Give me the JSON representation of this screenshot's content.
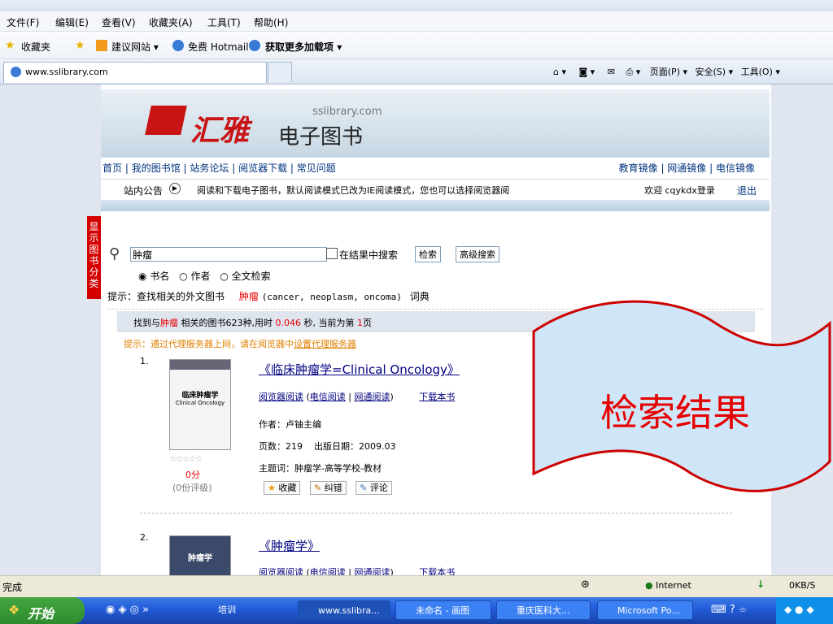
{
  "menu": [
    "文件(F)",
    "编辑(E)",
    "查看(V)",
    "收藏夹(A)",
    "工具(T)",
    "帮助(H)"
  ],
  "favbar": {
    "favorites": "收藏夹",
    "suggested": "建议网站",
    "hotmail": "免费 Hotmail",
    "addons": "获取更多加载项"
  },
  "tab": {
    "title": "www.sslibrary.com"
  },
  "commandbar": {
    "page": "页面(P)",
    "safety": "安全(S)",
    "tools": "工具(O)"
  },
  "banner": {
    "logo": "汇雅",
    "subtitle": "电子图书",
    "domain": "sslibrary.com"
  },
  "nav": [
    "首页",
    "我的图书馆",
    "站务论坛",
    "阅览器下载",
    "常见问题"
  ],
  "mirrors": [
    "教育镜像",
    "网通镜像",
    "电信镜像"
  ],
  "notice": {
    "label": "站内公告",
    "text": "阅读和下载电子图书，默认阅读模式已改为IE阅读模式，您也可以选择阅览器阅",
    "welcome": "欢迎 cqykdx登录",
    "logout": "退出"
  },
  "sidetab": "显示图书分类",
  "search": {
    "value": "肿瘤",
    "in_results": "在结果中搜索",
    "search_btn": "检索",
    "advanced_btn": "高级搜索",
    "options": [
      "书名",
      "作者",
      "全文检索"
    ],
    "hint_prefix": "提示：查找相关的外文图书",
    "hint_term": "肿瘤",
    "hint_terms": "(cancer, neoplasm, oncoma)",
    "dict": "词典"
  },
  "results_summary": {
    "pre": "找到与",
    "term": "肿瘤",
    "mid": " 相关的图书623种,用时 ",
    "time": "0.046",
    "mid2": " 秒, 当前为第 ",
    "page": "1",
    "post": "页"
  },
  "proxy_tip": {
    "text": "提示：通过代理服务器上网，请在阅览器中",
    "link": "设置代理服务器"
  },
  "results": [
    {
      "num": "1.",
      "cover_title": "临床肿瘤学",
      "cover_sub": "Clinical Oncology",
      "title": "《临床肿瘤学=Clinical Oncology》",
      "read_reader": "阅览器阅读",
      "read_telecom": "电信阅读",
      "read_netcom": "网通阅读",
      "download": "下载本书",
      "author": "作者：卢铀主编",
      "pages_date": "页数：219    出版日期：2009.03",
      "subject": "主题词：肿瘤学-高等学校-教材",
      "score": "0分",
      "ratings": "(0份评级)",
      "actions": [
        "收藏",
        "纠错",
        "评论"
      ]
    },
    {
      "num": "2.",
      "cover_title": "肿瘤学",
      "title": "《肿瘤学》",
      "read_reader": "阅览器阅读",
      "read_telecom": "电信阅读",
      "read_netcom": "网通阅读",
      "download": "下载本书"
    }
  ],
  "callout": "检索结果",
  "status": {
    "left": "完成",
    "zone": "Internet",
    "speed": "0KB/S"
  },
  "taskbar": {
    "start": "开始",
    "items": [
      "培训",
      "www.sslibra...",
      "未命名 - 画图",
      "重庆医科大...",
      "Microsoft Po..."
    ]
  },
  "colors": {
    "red": "#e60000",
    "callout_fill": "#cfe5f8",
    "callout_border": "#cc0000",
    "taskbar": "#245edb"
  }
}
